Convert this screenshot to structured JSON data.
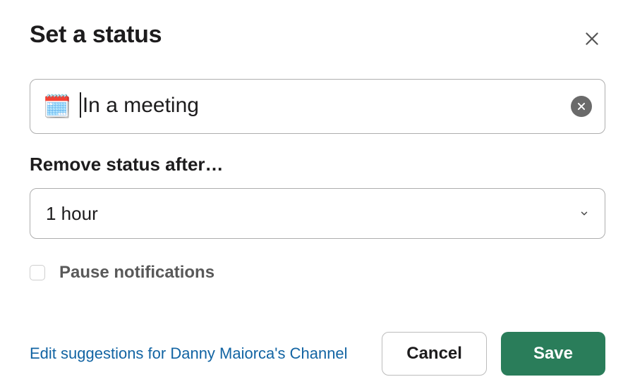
{
  "header": {
    "title": "Set a status"
  },
  "status": {
    "emoji": "🗓️",
    "text": "In a meeting"
  },
  "remove_after": {
    "label": "Remove status after…",
    "value": "1 hour"
  },
  "pause": {
    "label": "Pause notifications",
    "checked": false
  },
  "footer": {
    "edit_link": "Edit suggestions for Danny Maiorca's Channel",
    "cancel": "Cancel",
    "save": "Save"
  }
}
